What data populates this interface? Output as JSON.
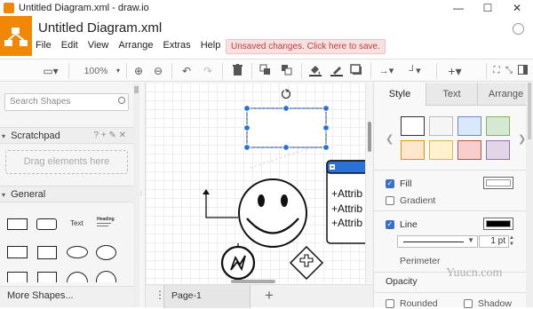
{
  "window": {
    "title": "Untitled Diagram.xml - draw.io",
    "controls": [
      "—",
      "☐",
      "✕"
    ]
  },
  "document": {
    "title": "Untitled Diagram.xml"
  },
  "menu": [
    "File",
    "Edit",
    "View",
    "Arrange",
    "Extras",
    "Help"
  ],
  "notice": "Unsaved changes. Click here to save.",
  "toolbar": {
    "zoom": "100%",
    "icons": [
      "view-icon",
      "zoom-in-icon",
      "zoom-out-icon",
      "undo-icon",
      "redo-icon",
      "delete-icon",
      "to-front-icon",
      "to-back-icon",
      "fill-color-icon",
      "line-color-icon",
      "shadow-icon",
      "connection-icon",
      "waypoints-icon",
      "insert-icon",
      "fullscreen-icon",
      "collapse-icon"
    ]
  },
  "sidebar": {
    "search_placeholder": "Search Shapes",
    "scratchpad": {
      "title": "Scratchpad",
      "tools": "? + ✎ ✕",
      "drop_hint": "Drag elements here"
    },
    "general": {
      "title": "General",
      "text_shape_label": "Text",
      "heading_shape_label": "Heading"
    },
    "more_shapes": "More Shapes..."
  },
  "canvas": {
    "class_attributes": [
      "+Attrib",
      "+Attrib",
      "+Attrib"
    ]
  },
  "pages": {
    "tab_label": "Page-1"
  },
  "format": {
    "tabs": [
      "Style",
      "Text",
      "Arrange"
    ],
    "active_tab": "Style",
    "swatches": [
      [
        "#ffffff",
        "#f5f5f5",
        "#dae8fc",
        "#d5e8d4"
      ],
      [
        "#ffe6cc",
        "#fff2cc",
        "#f8cecc",
        "#e1d5e7"
      ]
    ],
    "fill": {
      "label": "Fill",
      "checked": true,
      "color": "#ffffff"
    },
    "gradient": {
      "label": "Gradient",
      "checked": false
    },
    "line": {
      "label": "Line",
      "checked": true,
      "color": "#000000",
      "width": "1 pt"
    },
    "perimeter_label": "Perimeter",
    "opacity_label": "Opacity",
    "rounded": {
      "label": "Rounded",
      "checked": false
    },
    "shadow": {
      "label": "Shadow",
      "checked": false
    }
  },
  "watermark": "Yuucn.com"
}
